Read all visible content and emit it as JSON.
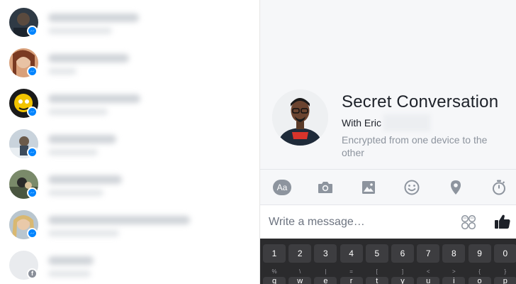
{
  "conversation_list": {
    "rows": [
      {
        "avatar_style": "dark",
        "badge": "messenger-icon"
      },
      {
        "avatar_style": "woman",
        "badge": "messenger-icon"
      },
      {
        "avatar_style": "yellow-cartoon",
        "badge": "messenger-icon"
      },
      {
        "avatar_style": "snow",
        "badge": "messenger-icon"
      },
      {
        "avatar_style": "outdoor",
        "badge": "messenger-icon"
      },
      {
        "avatar_style": "blonde",
        "badge": "messenger-icon"
      },
      {
        "avatar_style": "placeholder",
        "badge": "facebook-icon"
      }
    ]
  },
  "secret_conversation": {
    "title": "Secret Conversation",
    "with_label": "With Eric",
    "encryption_note": "Encrypted from one device to the other"
  },
  "toolbar": {
    "text_style_label": "Aa",
    "icons": [
      "text-style-icon",
      "camera-icon",
      "image-icon",
      "emoji-icon",
      "location-icon",
      "timer-icon"
    ]
  },
  "composer": {
    "placeholder": "Write a message…",
    "icons": [
      "sticker-icon",
      "thumbs-up-icon"
    ]
  },
  "keyboard": {
    "number_row": [
      "1",
      "2",
      "3",
      "4",
      "5",
      "6",
      "7",
      "8",
      "9",
      "0"
    ],
    "symbol_row": [
      "%",
      "\\",
      "|",
      "=",
      "[",
      "]",
      "<",
      ">",
      "{",
      "}"
    ],
    "letter_row": [
      "q",
      "w",
      "e",
      "r",
      "t",
      "y",
      "u",
      "i",
      "o",
      "p"
    ]
  },
  "colors": {
    "messenger_blue": "#0084ff",
    "icon_gray": "#8d949e",
    "keyboard_bg": "#2b2b2d"
  }
}
